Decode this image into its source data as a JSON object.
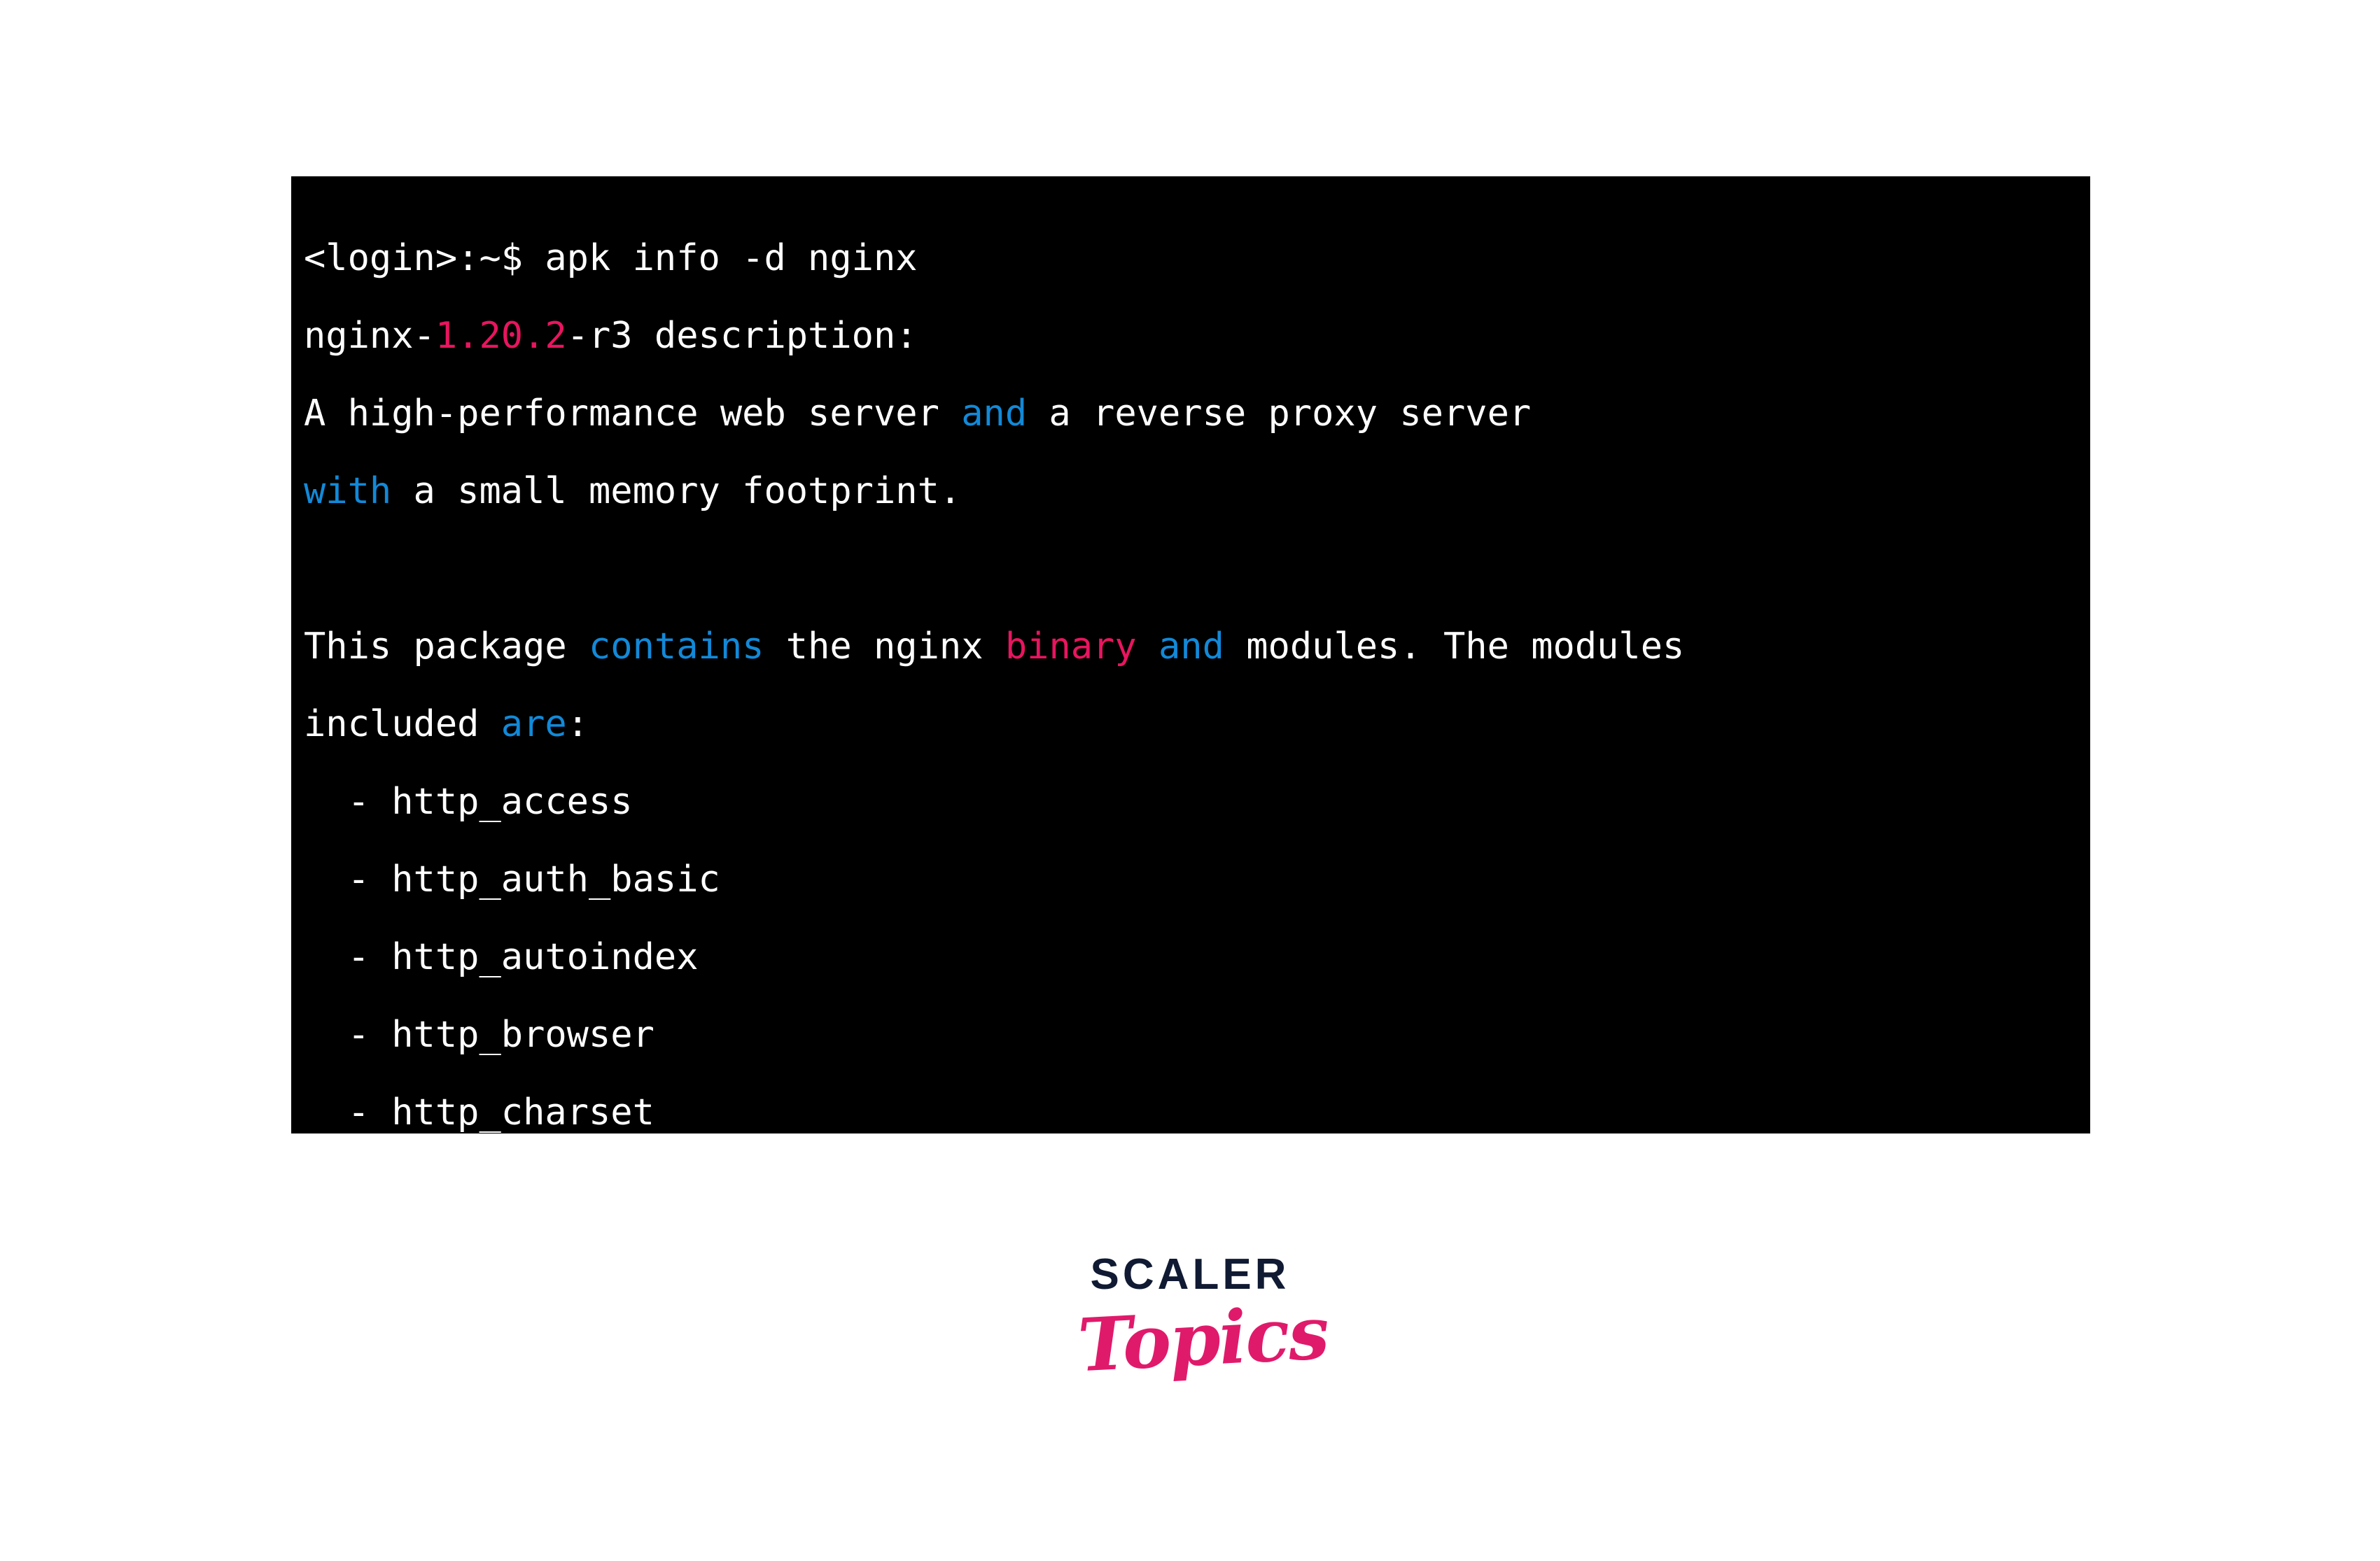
{
  "terminal": {
    "background_color": "#000000",
    "foreground_color": "#ffffff",
    "accent_pink": "#e8155f",
    "accent_blue": "#1289d8",
    "prompt": {
      "user_host": "<login>",
      "path": ":~$",
      "command": "apk info -d nginx",
      "full": "<login>:~$ apk info -d nginx"
    },
    "package": {
      "name": "nginx",
      "version": "1.20.2",
      "release": "-r3",
      "header_suffix": " description:"
    },
    "lines": [
      {
        "id": "prompt-line",
        "segments": [
          {
            "text": "<login>:~$ apk info -d nginx",
            "color": "white"
          }
        ]
      },
      {
        "id": "package-header-line",
        "segments": [
          {
            "text": "nginx-",
            "color": "white"
          },
          {
            "text": "1.20.2",
            "color": "pink"
          },
          {
            "text": "-r3 description:",
            "color": "white"
          }
        ]
      },
      {
        "id": "description-line-1",
        "segments": [
          {
            "text": "A high-performance web server ",
            "color": "white"
          },
          {
            "text": "and",
            "color": "blue"
          },
          {
            "text": " a reverse proxy server",
            "color": "white"
          }
        ]
      },
      {
        "id": "description-line-2",
        "segments": [
          {
            "text": "with",
            "color": "blue"
          },
          {
            "text": " a small memory footprint.",
            "color": "white"
          }
        ]
      },
      {
        "id": "blank-line",
        "segments": [
          {
            "text": " ",
            "color": "white"
          }
        ]
      },
      {
        "id": "contains-line-1",
        "segments": [
          {
            "text": "This package ",
            "color": "white"
          },
          {
            "text": "contains",
            "color": "blue"
          },
          {
            "text": " the nginx ",
            "color": "white"
          },
          {
            "text": "binary",
            "color": "pink"
          },
          {
            "text": " ",
            "color": "white"
          },
          {
            "text": "and",
            "color": "blue"
          },
          {
            "text": " modules. The modules",
            "color": "white"
          }
        ]
      },
      {
        "id": "contains-line-2",
        "segments": [
          {
            "text": "included ",
            "color": "white"
          },
          {
            "text": "are",
            "color": "blue"
          },
          {
            "text": ":",
            "color": "white"
          }
        ]
      },
      {
        "id": "module-http-access",
        "segments": [
          {
            "text": "  - http_access",
            "color": "white"
          }
        ]
      },
      {
        "id": "module-http-auth-basic",
        "segments": [
          {
            "text": "  - http_auth_basic",
            "color": "white"
          }
        ]
      },
      {
        "id": "module-http-autoindex",
        "segments": [
          {
            "text": "  - http_autoindex",
            "color": "white"
          }
        ]
      },
      {
        "id": "module-http-browser",
        "segments": [
          {
            "text": "  - http_browser",
            "color": "white"
          }
        ]
      },
      {
        "id": "module-http-charset",
        "segments": [
          {
            "text": "  - http_charset",
            "color": "white"
          }
        ]
      }
    ],
    "modules": [
      "http_access",
      "http_auth_basic",
      "http_autoindex",
      "http_browser",
      "http_charset"
    ]
  },
  "logo": {
    "word_top": "SCALER",
    "word_bottom": "Topics",
    "color_top": "#101a33",
    "color_bottom": "#e01a6b"
  }
}
